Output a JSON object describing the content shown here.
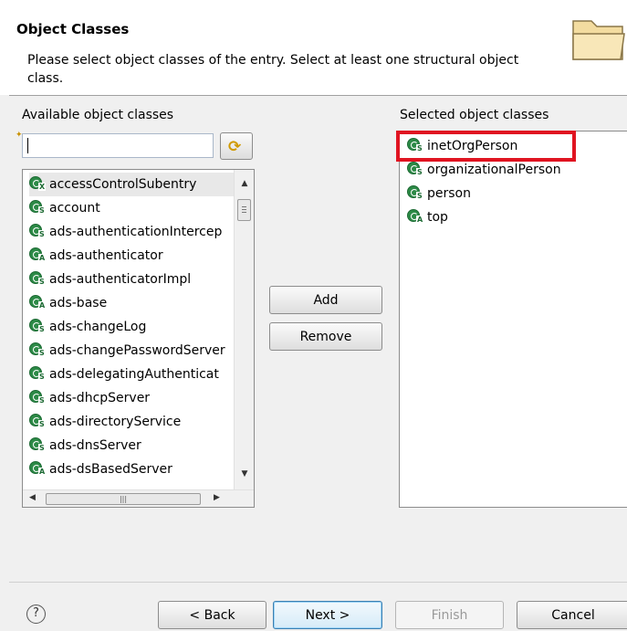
{
  "header": {
    "title": "Object Classes",
    "description": "Please select object classes of the entry. Select at least one structural object class.",
    "icon": "folder-icon"
  },
  "available": {
    "label": "Available object classes",
    "filter_value": "",
    "items": [
      {
        "name": "accessControlSubentry",
        "kind": "X"
      },
      {
        "name": "account",
        "kind": "S"
      },
      {
        "name": "ads-authenticationIntercep",
        "kind": "S"
      },
      {
        "name": "ads-authenticator",
        "kind": "A"
      },
      {
        "name": "ads-authenticatorImpl",
        "kind": "S"
      },
      {
        "name": "ads-base",
        "kind": "A"
      },
      {
        "name": "ads-changeLog",
        "kind": "S"
      },
      {
        "name": "ads-changePasswordServer",
        "kind": "S"
      },
      {
        "name": "ads-delegatingAuthenticat",
        "kind": "S"
      },
      {
        "name": "ads-dhcpServer",
        "kind": "S"
      },
      {
        "name": "ads-directoryService",
        "kind": "S"
      },
      {
        "name": "ads-dnsServer",
        "kind": "S"
      },
      {
        "name": "ads-dsBasedServer",
        "kind": "A"
      }
    ]
  },
  "actions": {
    "add": "Add",
    "remove": "Remove"
  },
  "selected": {
    "label": "Selected object classes",
    "items": [
      {
        "name": "inetOrgPerson",
        "kind": "S"
      },
      {
        "name": "organizationalPerson",
        "kind": "S"
      },
      {
        "name": "person",
        "kind": "S"
      },
      {
        "name": "top",
        "kind": "A"
      }
    ]
  },
  "footer": {
    "help": "?",
    "back": "< Back",
    "next": "Next >",
    "finish": "Finish",
    "cancel": "Cancel"
  }
}
